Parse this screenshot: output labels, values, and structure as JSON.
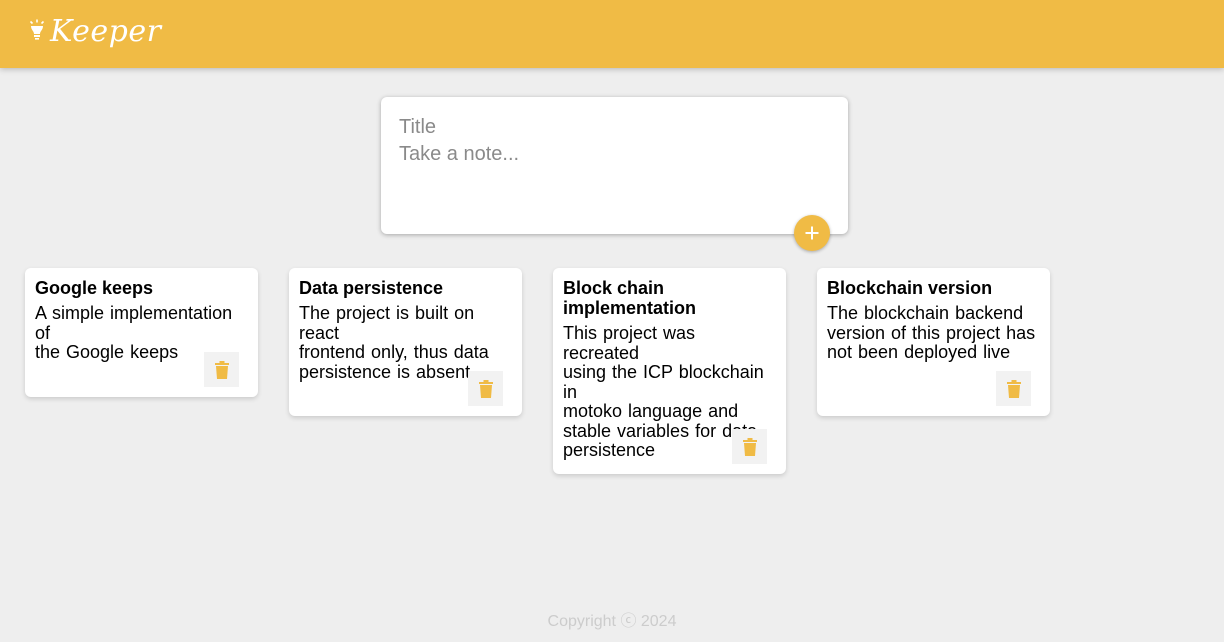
{
  "header": {
    "title": "Keeper",
    "icon": "lightbulb-icon"
  },
  "create_note": {
    "title_placeholder": "Title",
    "content_placeholder": "Take a note...",
    "add_icon": "plus-icon"
  },
  "notes": [
    {
      "title": "Google keeps",
      "content": "A simple implementation of\nthe Google keeps",
      "delete_icon": "trash-icon"
    },
    {
      "title": "Data persistence",
      "content": "The project is built on react\nfrontend only, thus data\npersistence is absent",
      "delete_icon": "trash-icon"
    },
    {
      "title": "Block chain implementation",
      "content": "This project was recreated\nusing the ICP blockchain in\nmotoko language and\nstable variables for data\npersistence",
      "delete_icon": "trash-icon"
    },
    {
      "title": "Blockchain version",
      "content": "The blockchain backend\nversion of this project has\nnot been deployed live",
      "delete_icon": "trash-icon"
    }
  ],
  "footer": {
    "copyright": "Copyright ⓒ 2024"
  },
  "colors": {
    "brand": "#f0bb45",
    "background": "#eeeeee",
    "card": "#ffffff",
    "footer_text": "#cccccc"
  }
}
